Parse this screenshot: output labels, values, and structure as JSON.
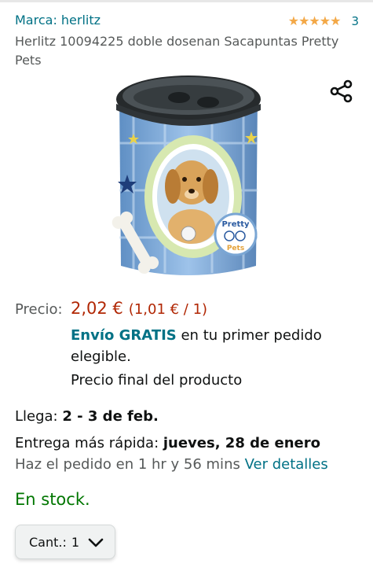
{
  "product": {
    "brand": "Marca: herlitz",
    "rating_count": "3",
    "title": "Herlitz 10094225 doble dosenan Sacapuntas Pretty Pets",
    "image_name": "product-image",
    "image_text": "Pretty Pets"
  },
  "price": {
    "label": "Precio:",
    "value": "2,02 €",
    "unit": "(1,01 € / 1)"
  },
  "delivery": {
    "free_label": "Envío GRATIS",
    "free_rest": " en tu primer pedido elegible.",
    "final_price": "Precio final del producto",
    "arrives_label": "Llega: ",
    "arrives_date": "2 - 3 de feb.",
    "fast_label": "Entrega más rápida: ",
    "fast_date": "jueves, 28 de enero",
    "order_by": "Haz el pedido en 1 hr y 56 mins ",
    "details_link": "Ver detalles"
  },
  "stock": {
    "status": "En stock."
  },
  "quantity": {
    "label": "Cant.:",
    "value": "1"
  },
  "colors": {
    "link": "#007185",
    "price": "#b12704",
    "stock": "#007600",
    "star": "#f3a847"
  },
  "icons": [
    "star-icon",
    "share-icon",
    "chevron-down-icon"
  ]
}
